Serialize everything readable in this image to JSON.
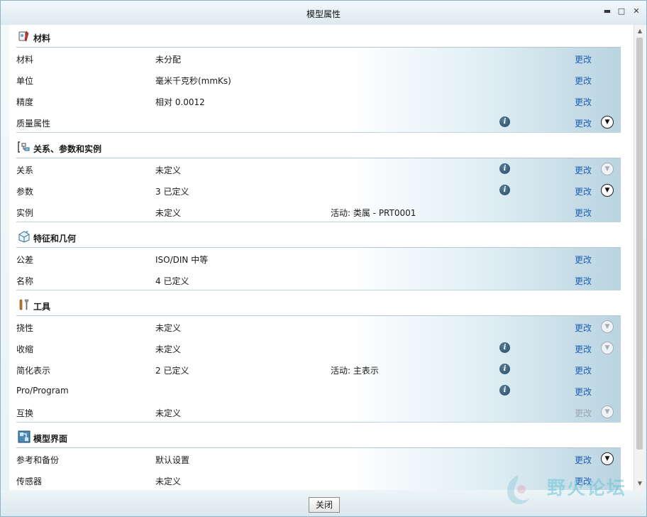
{
  "window": {
    "title": "模型属性",
    "minimize_glyph": "▬",
    "maximize_glyph": "□",
    "close_glyph": "✕"
  },
  "colors": {
    "link": "#1f5fb8",
    "accent": "#b9d4e0"
  },
  "sections": [
    {
      "title": "材料",
      "icon": "material-icon",
      "rows": [
        {
          "label": "材料",
          "value": "未分配",
          "extra": "",
          "info": false,
          "change": "更改",
          "change_enabled": true,
          "expand": "none"
        },
        {
          "label": "单位",
          "value": "毫米千克秒(mmKs)",
          "extra": "",
          "info": false,
          "change": "更改",
          "change_enabled": true,
          "expand": "none"
        },
        {
          "label": "精度",
          "value": "相对 0.0012",
          "extra": "",
          "info": false,
          "change": "更改",
          "change_enabled": true,
          "expand": "none"
        },
        {
          "label": "质量属性",
          "value": "",
          "extra": "",
          "info": true,
          "change": "更改",
          "change_enabled": true,
          "expand": "active"
        }
      ]
    },
    {
      "title": "关系、参数和实例",
      "icon": "relations-icon",
      "rows": [
        {
          "label": "关系",
          "value": "未定义",
          "extra": "",
          "info": true,
          "change": "更改",
          "change_enabled": true,
          "expand": "disabled"
        },
        {
          "label": "参数",
          "value": "3 已定义",
          "extra": "",
          "info": true,
          "change": "更改",
          "change_enabled": true,
          "expand": "active"
        },
        {
          "label": "实例",
          "value": "未定义",
          "extra": "活动: 类属 - PRT0001",
          "info": false,
          "change": "更改",
          "change_enabled": true,
          "expand": "none"
        }
      ]
    },
    {
      "title": "特征和几何",
      "icon": "feature-icon",
      "rows": [
        {
          "label": "公差",
          "value": "ISO/DIN 中等",
          "extra": "",
          "info": false,
          "change": "更改",
          "change_enabled": true,
          "expand": "none"
        },
        {
          "label": "名称",
          "value": "4 已定义",
          "extra": "",
          "info": false,
          "change": "更改",
          "change_enabled": true,
          "expand": "none"
        }
      ]
    },
    {
      "title": "工具",
      "icon": "tools-icon",
      "rows": [
        {
          "label": "挠性",
          "value": "未定义",
          "extra": "",
          "info": false,
          "change": "更改",
          "change_enabled": true,
          "expand": "disabled"
        },
        {
          "label": "收缩",
          "value": "未定义",
          "extra": "",
          "info": true,
          "change": "更改",
          "change_enabled": true,
          "expand": "disabled"
        },
        {
          "label": "简化表示",
          "value": "2 已定义",
          "extra": "活动: 主表示",
          "info": true,
          "change": "更改",
          "change_enabled": true,
          "expand": "none"
        },
        {
          "label": "Pro/Program",
          "value": "",
          "extra": "",
          "info": true,
          "change": "更改",
          "change_enabled": true,
          "expand": "none"
        },
        {
          "label": "互换",
          "value": "未定义",
          "extra": "",
          "info": false,
          "change": "更改",
          "change_enabled": false,
          "expand": "disabled"
        }
      ]
    },
    {
      "title": "模型界面",
      "icon": "model-interface-icon",
      "rows": [
        {
          "label": "参考和备份",
          "value": "默认设置",
          "extra": "",
          "info": false,
          "change": "更改",
          "change_enabled": true,
          "expand": "active"
        },
        {
          "label": "传感器",
          "value": "未定义",
          "extra": "",
          "info": false,
          "change": "更改",
          "change_enabled": true,
          "expand": "none"
        }
      ]
    }
  ],
  "footer": {
    "close_label": "关闭"
  },
  "watermark": {
    "text": "野火论坛"
  }
}
